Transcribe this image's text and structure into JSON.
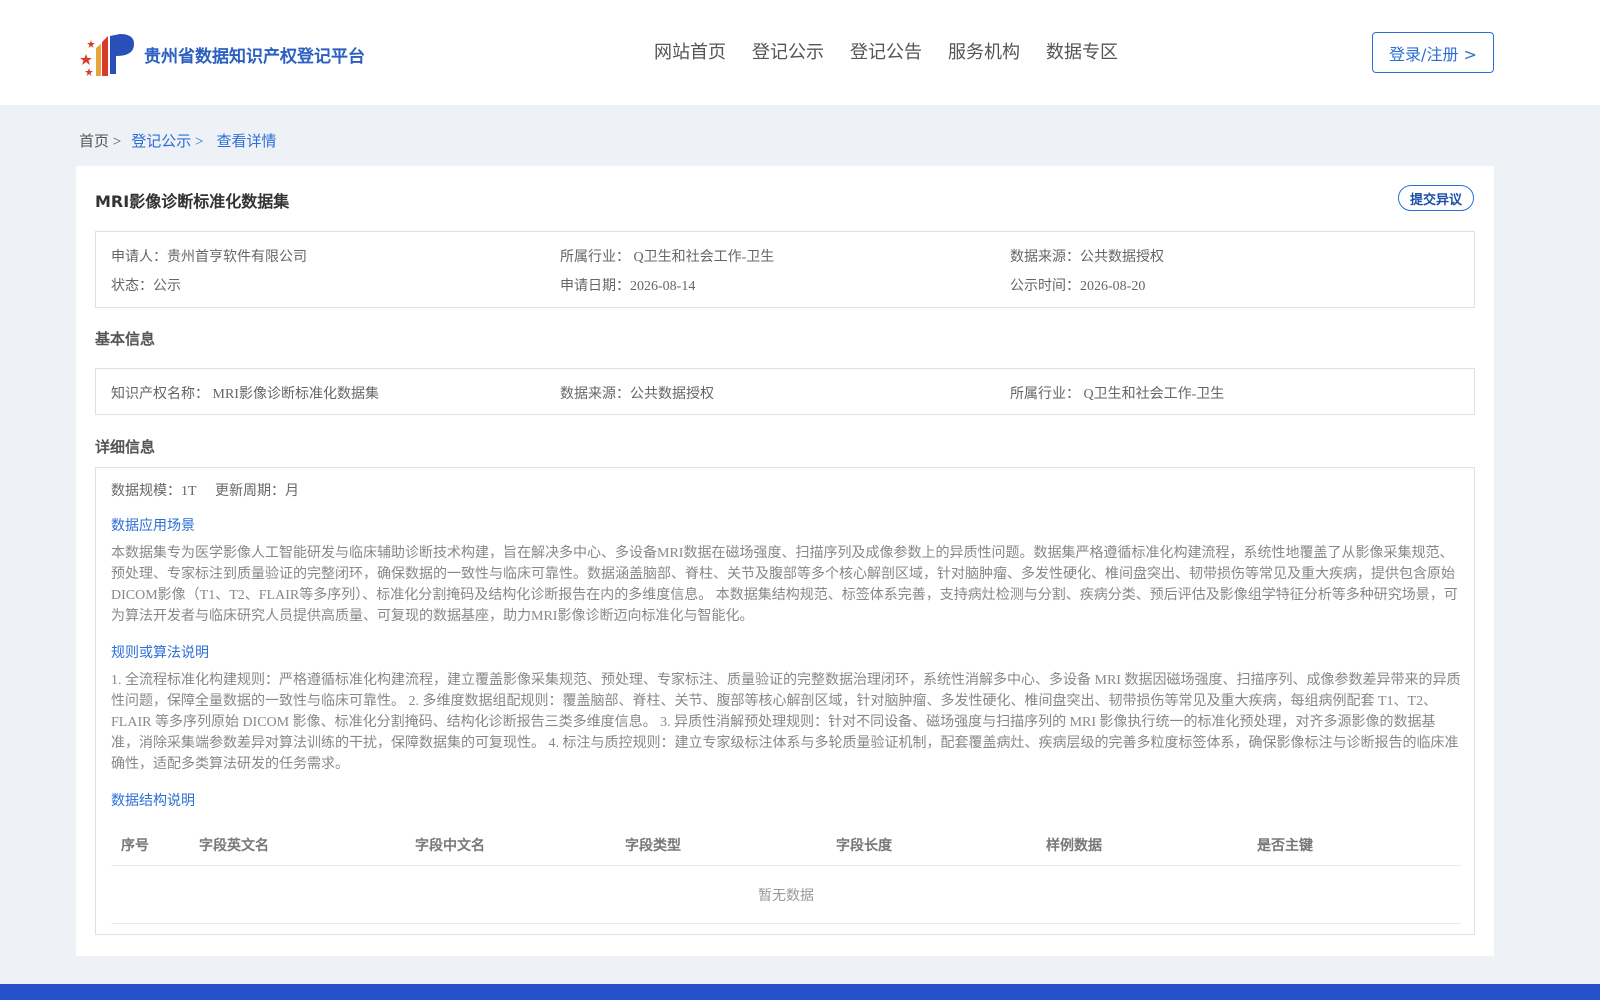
{
  "header": {
    "site_title": "贵州省数据知识产权登记平台",
    "nav": [
      "网站首页",
      "登记公示",
      "登记公告",
      "服务机构",
      "数据专区"
    ],
    "login_label": "登录/注册 >"
  },
  "breadcrumb": {
    "home": "首页 >",
    "section": "登记公示 >",
    "current": "查看详情"
  },
  "detail": {
    "title": "MRI影像诊断标准化数据集",
    "objection_label": "提交异议",
    "summary": {
      "applicant": "申请人：贵州首亨软件有限公司",
      "industry": "所属行业： Q卫生和社会工作-卫生",
      "source": "数据来源：公共数据授权",
      "status": "状态：公示",
      "apply_date": "申请日期：2026-08-14",
      "publish_date": "公示时间：2026-08-20"
    },
    "basic_title": "基本信息",
    "basic": {
      "ip_name": "知识产权名称： MRI影像诊断标准化数据集",
      "source": "数据来源：公共数据授权",
      "industry": "所属行业： Q卫生和社会工作-卫生"
    },
    "detail_title": "详细信息",
    "scale": "数据规模：1T",
    "cycle": "更新周期：月",
    "scenario_title": "数据应用场景",
    "scenario_text": "本数据集专为医学影像人工智能研发与临床辅助诊断技术构建，旨在解决多中心、多设备MRI数据在磁场强度、扫描序列及成像参数上的异质性问题。数据集严格遵循标准化构建流程，系统性地覆盖了从影像采集规范、预处理、专家标注到质量验证的完整闭环，确保数据的一致性与临床可靠性。数据涵盖脑部、脊柱、关节及腹部等多个核心解剖区域，针对脑肿瘤、多发性硬化、椎间盘突出、韧带损伤等常见及重大疾病，提供包含原始DICOM影像（T1、T2、FLAIR等多序列）、标准化分割掩码及结构化诊断报告在内的多维度信息。 本数据集结构规范、标签体系完善，支持病灶检测与分割、疾病分类、预后评估及影像组学特征分析等多种研究场景，可为算法开发者与临床研究人员提供高质量、可复现的数据基座，助力MRI影像诊断迈向标准化与智能化。",
    "rules_title": "规则或算法说明",
    "rules_text": "1. 全流程标准化构建规则：严格遵循标准化构建流程，建立覆盖影像采集规范、预处理、专家标注、质量验证的完整数据治理闭环，系统性消解多中心、多设备 MRI 数据因磁场强度、扫描序列、成像参数差异带来的异质性问题，保障全量数据的一致性与临床可靠性。 2. 多维度数据组配规则：覆盖脑部、脊柱、关节、腹部等核心解剖区域，针对脑肿瘤、多发性硬化、椎间盘突出、韧带损伤等常见及重大疾病，每组病例配套 T1、T2、FLAIR 等多序列原始 DICOM 影像、标准化分割掩码、结构化诊断报告三类多维度信息。 3. 异质性消解预处理规则：针对不同设备、磁场强度与扫描序列的 MRI 影像执行统一的标准化预处理，对齐多源影像的数据基准，消除采集端参数差异对算法训练的干扰，保障数据集的可复现性。 4. 标注与质控规则：建立专家级标注体系与多轮质量验证机制，配套覆盖病灶、疾病层级的完善多粒度标签体系，确保影像标注与诊断报告的临床准确性，适配多类算法研发的任务需求。",
    "structure_title": "数据结构说明",
    "table_headers": [
      "序号",
      "字段英文名",
      "字段中文名",
      "字段类型",
      "字段长度",
      "样例数据",
      "是否主键"
    ],
    "empty_text": "暂无数据"
  }
}
